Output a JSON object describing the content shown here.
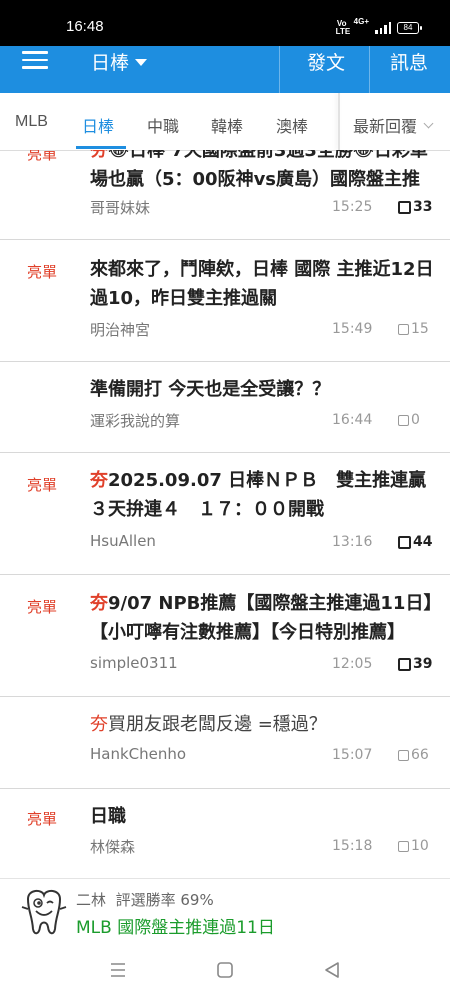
{
  "status_bar": {
    "time": "16:48",
    "volte_label": "Vo LTE",
    "signal_label": "4G+",
    "battery": "84"
  },
  "app_bar": {
    "section": "日棒",
    "post_button": "發文",
    "messages_button": "訊息"
  },
  "tabs": [
    {
      "label": "MLB",
      "active": false
    },
    {
      "label": "日棒",
      "active": true
    },
    {
      "label": "中職",
      "active": false
    },
    {
      "label": "韓棒",
      "active": false
    },
    {
      "label": "澳棒",
      "active": false
    }
  ],
  "sort": {
    "label": "最新回覆"
  },
  "posts": [
    {
      "tag": "亮單",
      "prefix": "夯",
      "title": "😂日棒 7天國際盤前3過3全勝😂日彩單場也贏（5：00阪神vs廣島）國際盤主推",
      "author": "哥哥妹妹",
      "time": "15:25",
      "replies": "33",
      "hot": true
    },
    {
      "tag": "亮單",
      "prefix": "",
      "title": "來都來了，鬥陣欸，日棒 國際 主推近12日過10，昨日雙主推過關",
      "author": "明治神宮",
      "time": "15:49",
      "replies": "15",
      "hot": false
    },
    {
      "tag": "",
      "prefix": "",
      "title": "準備開打 今天也是全受讓？？",
      "author": "運彩我說的算",
      "time": "16:44",
      "replies": "0",
      "hot": false
    },
    {
      "tag": "亮單",
      "prefix": "夯",
      "title": "2025.09.07 日棒ＮＰＢ　雙主推連贏３天拚連４　１７：００開戰",
      "author": "HsuAllen",
      "time": "13:16",
      "replies": "44",
      "hot": true
    },
    {
      "tag": "亮單",
      "prefix": "夯",
      "title": "9/07 NPB推薦【國際盤主推連過11日】【小叮嚀有注數推薦】【今日特別推薦】",
      "author": "simple0311",
      "time": "12:05",
      "replies": "39",
      "hot": true
    },
    {
      "tag": "",
      "prefix": "夯",
      "title": "買朋友跟老闆反邊 =穩過？",
      "author": "HankChenho",
      "time": "15:07",
      "replies": "66",
      "hot": false
    },
    {
      "tag": "亮單",
      "prefix": "",
      "title": "日職",
      "author": "林傑森",
      "time": "15:18",
      "replies": "10",
      "hot": false
    }
  ],
  "banner": {
    "name": "二林",
    "rating_label": "評選勝率",
    "rating_value": "69%",
    "link": "MLB 國際盤主推連過11日"
  },
  "colors": {
    "primary": "#1e8ee0",
    "tag_red": "#e0402a",
    "link_green": "#1b9c2c"
  },
  "icons": {
    "menu": "hamburger-icon",
    "section_dropdown": "caret-down-icon",
    "sort": "chevron-down-icon",
    "reply": "reply-count-icon",
    "nav_recents": "recent-apps-icon",
    "nav_home": "home-icon",
    "nav_back": "back-icon"
  }
}
